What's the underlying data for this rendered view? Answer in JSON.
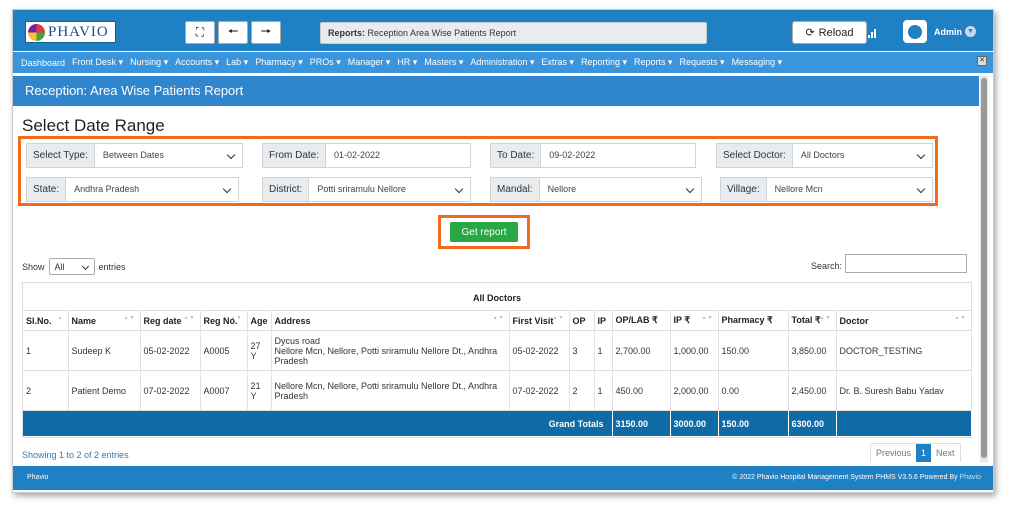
{
  "app": {
    "logo_text": "PHAVIO",
    "breadcrumb_prefix": "Reports:",
    "breadcrumb_page": "Reception Area Wise Patients Report",
    "reload_label": "Reload",
    "user": "Admin"
  },
  "menu": [
    "Dashboard",
    "Front Desk ▾",
    "Nursing ▾",
    "Accounts ▾",
    "Lab ▾",
    "Pharmacy ▾",
    "PROs ▾",
    "Manager ▾",
    "HR ▾",
    "Masters ▾",
    "Administration ▾",
    "Extras ▾",
    "Reporting ▾",
    "Reports ▾",
    "Requests ▾",
    "Messaging ▾"
  ],
  "page_title": "Reception: Area Wise Patients Report",
  "section_title": "Select Date Range",
  "filters": {
    "select_type_label": "Select Type:",
    "select_type_value": "Between Dates",
    "from_label": "From Date:",
    "from_value": "01-02-2022",
    "to_label": "To Date:",
    "to_value": "09-02-2022",
    "doctor_label": "Select Doctor:",
    "doctor_value": "All Doctors",
    "state_label": "State:",
    "state_value": "Andhra Pradesh",
    "district_label": "District:",
    "district_value": "Potti sriramulu Nellore",
    "mandal_label": "Mandal:",
    "mandal_value": "Nellore",
    "village_label": "Village:",
    "village_value": "Nellore Mcn"
  },
  "get_report": "Get report",
  "table_controls": {
    "show": "Show",
    "entries_value": "All",
    "entries": "entries",
    "search": "Search:"
  },
  "table": {
    "caption": "All Doctors",
    "headers": [
      "Sl.No.",
      "Name",
      "Reg date",
      "Reg No.",
      "Age",
      "Address",
      "First Visit",
      "OP",
      "IP",
      "OP/LAB ₹",
      "IP ₹",
      "Pharmacy ₹",
      "Total ₹",
      "Doctor"
    ],
    "rows": [
      [
        "1",
        "Sudeep K",
        "05-02-2022",
        "A0005",
        "27 Y",
        "Dycus road\nNellore Mcn, Nellore, Potti sriramulu Nellore Dt., Andhra Pradesh",
        "05-02-2022",
        "3",
        "1",
        "2,700.00",
        "1,000.00",
        "150.00",
        "3,850.00",
        "DOCTOR_TESTING"
      ],
      [
        "2",
        "Patient Demo",
        "07-02-2022",
        "A0007",
        "21 Y",
        "Nellore Mcn, Nellore, Potti sriramulu Nellore Dt., Andhra Pradesh",
        "07-02-2022",
        "2",
        "1",
        "450.00",
        "2,000.00",
        "0.00",
        "2,450.00",
        "Dr. B. Suresh Babu Yadav"
      ]
    ],
    "totals": {
      "label": "Grand Totals",
      "op_lab": "3150.00",
      "ip": "3000.00",
      "pharmacy": "150.00",
      "total": "6300.00"
    }
  },
  "showing": "Showing 1 to 2 of 2 entries",
  "pager": {
    "prev": "Previous",
    "page": "1",
    "next": "Next"
  },
  "footer": {
    "left": "Phavio",
    "right": "© 2022 Phavio Hospital Management System PHMS V3.5.6 Powered By",
    "right_brand": "Phavio"
  }
}
